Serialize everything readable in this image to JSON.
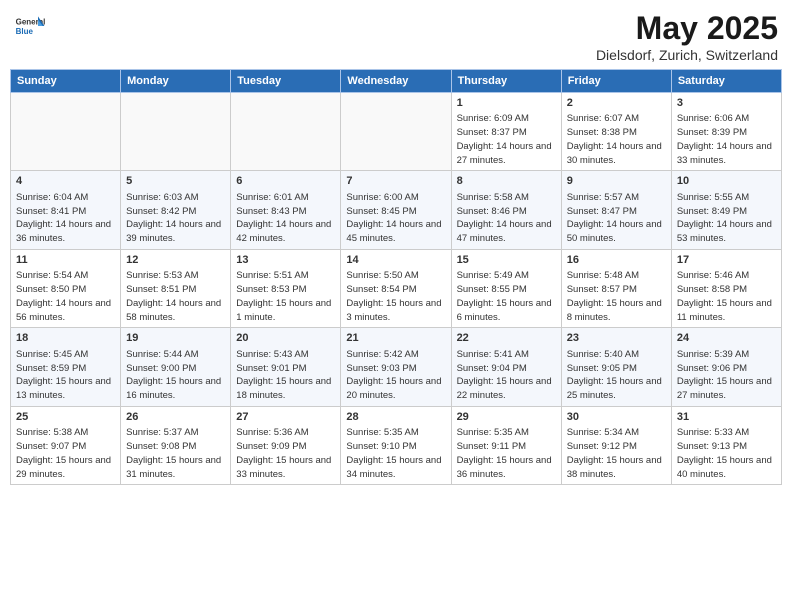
{
  "header": {
    "logo_general": "General",
    "logo_blue": "Blue",
    "month_title": "May 2025",
    "location": "Dielsdorf, Zurich, Switzerland"
  },
  "days_of_week": [
    "Sunday",
    "Monday",
    "Tuesday",
    "Wednesday",
    "Thursday",
    "Friday",
    "Saturday"
  ],
  "weeks": [
    {
      "days": [
        {
          "number": "",
          "info": ""
        },
        {
          "number": "",
          "info": ""
        },
        {
          "number": "",
          "info": ""
        },
        {
          "number": "",
          "info": ""
        },
        {
          "number": "1",
          "info": "Sunrise: 6:09 AM\nSunset: 8:37 PM\nDaylight: 14 hours\nand 27 minutes."
        },
        {
          "number": "2",
          "info": "Sunrise: 6:07 AM\nSunset: 8:38 PM\nDaylight: 14 hours\nand 30 minutes."
        },
        {
          "number": "3",
          "info": "Sunrise: 6:06 AM\nSunset: 8:39 PM\nDaylight: 14 hours\nand 33 minutes."
        }
      ]
    },
    {
      "days": [
        {
          "number": "4",
          "info": "Sunrise: 6:04 AM\nSunset: 8:41 PM\nDaylight: 14 hours\nand 36 minutes."
        },
        {
          "number": "5",
          "info": "Sunrise: 6:03 AM\nSunset: 8:42 PM\nDaylight: 14 hours\nand 39 minutes."
        },
        {
          "number": "6",
          "info": "Sunrise: 6:01 AM\nSunset: 8:43 PM\nDaylight: 14 hours\nand 42 minutes."
        },
        {
          "number": "7",
          "info": "Sunrise: 6:00 AM\nSunset: 8:45 PM\nDaylight: 14 hours\nand 45 minutes."
        },
        {
          "number": "8",
          "info": "Sunrise: 5:58 AM\nSunset: 8:46 PM\nDaylight: 14 hours\nand 47 minutes."
        },
        {
          "number": "9",
          "info": "Sunrise: 5:57 AM\nSunset: 8:47 PM\nDaylight: 14 hours\nand 50 minutes."
        },
        {
          "number": "10",
          "info": "Sunrise: 5:55 AM\nSunset: 8:49 PM\nDaylight: 14 hours\nand 53 minutes."
        }
      ]
    },
    {
      "days": [
        {
          "number": "11",
          "info": "Sunrise: 5:54 AM\nSunset: 8:50 PM\nDaylight: 14 hours\nand 56 minutes."
        },
        {
          "number": "12",
          "info": "Sunrise: 5:53 AM\nSunset: 8:51 PM\nDaylight: 14 hours\nand 58 minutes."
        },
        {
          "number": "13",
          "info": "Sunrise: 5:51 AM\nSunset: 8:53 PM\nDaylight: 15 hours\nand 1 minute."
        },
        {
          "number": "14",
          "info": "Sunrise: 5:50 AM\nSunset: 8:54 PM\nDaylight: 15 hours\nand 3 minutes."
        },
        {
          "number": "15",
          "info": "Sunrise: 5:49 AM\nSunset: 8:55 PM\nDaylight: 15 hours\nand 6 minutes."
        },
        {
          "number": "16",
          "info": "Sunrise: 5:48 AM\nSunset: 8:57 PM\nDaylight: 15 hours\nand 8 minutes."
        },
        {
          "number": "17",
          "info": "Sunrise: 5:46 AM\nSunset: 8:58 PM\nDaylight: 15 hours\nand 11 minutes."
        }
      ]
    },
    {
      "days": [
        {
          "number": "18",
          "info": "Sunrise: 5:45 AM\nSunset: 8:59 PM\nDaylight: 15 hours\nand 13 minutes."
        },
        {
          "number": "19",
          "info": "Sunrise: 5:44 AM\nSunset: 9:00 PM\nDaylight: 15 hours\nand 16 minutes."
        },
        {
          "number": "20",
          "info": "Sunrise: 5:43 AM\nSunset: 9:01 PM\nDaylight: 15 hours\nand 18 minutes."
        },
        {
          "number": "21",
          "info": "Sunrise: 5:42 AM\nSunset: 9:03 PM\nDaylight: 15 hours\nand 20 minutes."
        },
        {
          "number": "22",
          "info": "Sunrise: 5:41 AM\nSunset: 9:04 PM\nDaylight: 15 hours\nand 22 minutes."
        },
        {
          "number": "23",
          "info": "Sunrise: 5:40 AM\nSunset: 9:05 PM\nDaylight: 15 hours\nand 25 minutes."
        },
        {
          "number": "24",
          "info": "Sunrise: 5:39 AM\nSunset: 9:06 PM\nDaylight: 15 hours\nand 27 minutes."
        }
      ]
    },
    {
      "days": [
        {
          "number": "25",
          "info": "Sunrise: 5:38 AM\nSunset: 9:07 PM\nDaylight: 15 hours\nand 29 minutes."
        },
        {
          "number": "26",
          "info": "Sunrise: 5:37 AM\nSunset: 9:08 PM\nDaylight: 15 hours\nand 31 minutes."
        },
        {
          "number": "27",
          "info": "Sunrise: 5:36 AM\nSunset: 9:09 PM\nDaylight: 15 hours\nand 33 minutes."
        },
        {
          "number": "28",
          "info": "Sunrise: 5:35 AM\nSunset: 9:10 PM\nDaylight: 15 hours\nand 34 minutes."
        },
        {
          "number": "29",
          "info": "Sunrise: 5:35 AM\nSunset: 9:11 PM\nDaylight: 15 hours\nand 36 minutes."
        },
        {
          "number": "30",
          "info": "Sunrise: 5:34 AM\nSunset: 9:12 PM\nDaylight: 15 hours\nand 38 minutes."
        },
        {
          "number": "31",
          "info": "Sunrise: 5:33 AM\nSunset: 9:13 PM\nDaylight: 15 hours\nand 40 minutes."
        }
      ]
    }
  ]
}
